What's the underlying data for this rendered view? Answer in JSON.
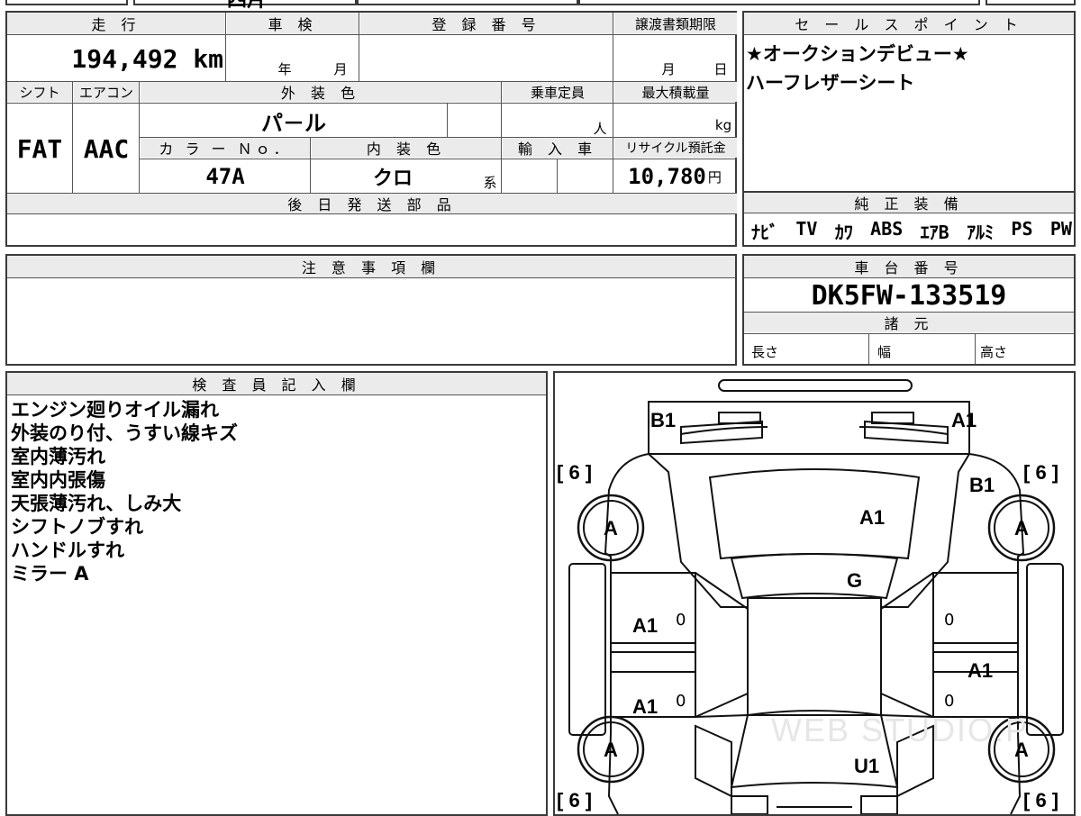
{
  "top_strip": {
    "partial_text": "四片"
  },
  "vehicle": {
    "mileage_label": "走 行",
    "mileage_value": "194,492 km",
    "inspection_label": "車 検",
    "inspection_year": "年",
    "inspection_month": "月",
    "registration_label": "登 録 番 号",
    "transfer_deadline_label": "譲渡書類期限",
    "transfer_month": "月",
    "transfer_day": "日",
    "shift_label": "シフト",
    "shift_value": "FAT",
    "aircon_label": "エアコン",
    "aircon_value": "AAC",
    "exterior_color_label": "外 装 色",
    "exterior_color_value": "パ－ル",
    "capacity_label": "乗車定員",
    "capacity_unit": "人",
    "max_load_label": "最大積載量",
    "max_load_unit": "kg",
    "color_no_label": "カ ラ ー Ｎｏ．",
    "color_no_value": "47A",
    "interior_color_label": "内 装 色",
    "interior_color_value": "クロ",
    "interior_color_suffix": "系",
    "import_label": "輸 入 車",
    "recycle_label": "リサイクル預託金",
    "recycle_value": "10,780",
    "recycle_unit": "円",
    "later_parts_label": "後 日 発 送 部 品"
  },
  "sales_points": {
    "header": "セ ー ル ス ポ イ ン ト",
    "lines": [
      "★オークションデビュー★",
      "ハーフレザーシート"
    ]
  },
  "equipment": {
    "header": "純 正 装 備",
    "items": [
      "ﾅﾋﾞ",
      "TV",
      "ｶﾜ",
      "ABS",
      "ｴｱB",
      "ｱﾙﾐ",
      "PS",
      "PW"
    ]
  },
  "caution": {
    "header": "注 意 事 項 欄"
  },
  "chassis": {
    "header": "車 台 番 号",
    "value": "DK5FW-133519",
    "specs_header": "諸 元",
    "length_label": "長さ",
    "width_label": "幅",
    "height_label": "高さ"
  },
  "inspector": {
    "header": "検 査 員 記 入 欄",
    "notes": [
      "エンジン廻りオイル漏れ",
      "外装のり付、うすい線キズ",
      "室内薄汚れ",
      "室内内張傷",
      "天張薄汚れ、しみ大",
      "シフトノブすれ",
      "ハンドルすれ",
      "ミラー A"
    ]
  },
  "damage_map": {
    "rear_left": "B1",
    "rear_right": "A1",
    "side_right_upper": "B1",
    "rear_glass": "A1",
    "roof": "G",
    "left_door_front": "A1",
    "left_door_rear": "A1",
    "right_door": "A1",
    "hood": "U1",
    "tire_marks": [
      "A",
      "A",
      "A",
      "A"
    ],
    "tire_depths": [
      "[ 6 ]",
      "[ 6 ]",
      "[ 6 ]",
      "[ 6 ]"
    ],
    "door_zero_marks": [
      "0",
      "0",
      "0",
      "0"
    ],
    "watermark": "WEB STUDIO.P"
  }
}
